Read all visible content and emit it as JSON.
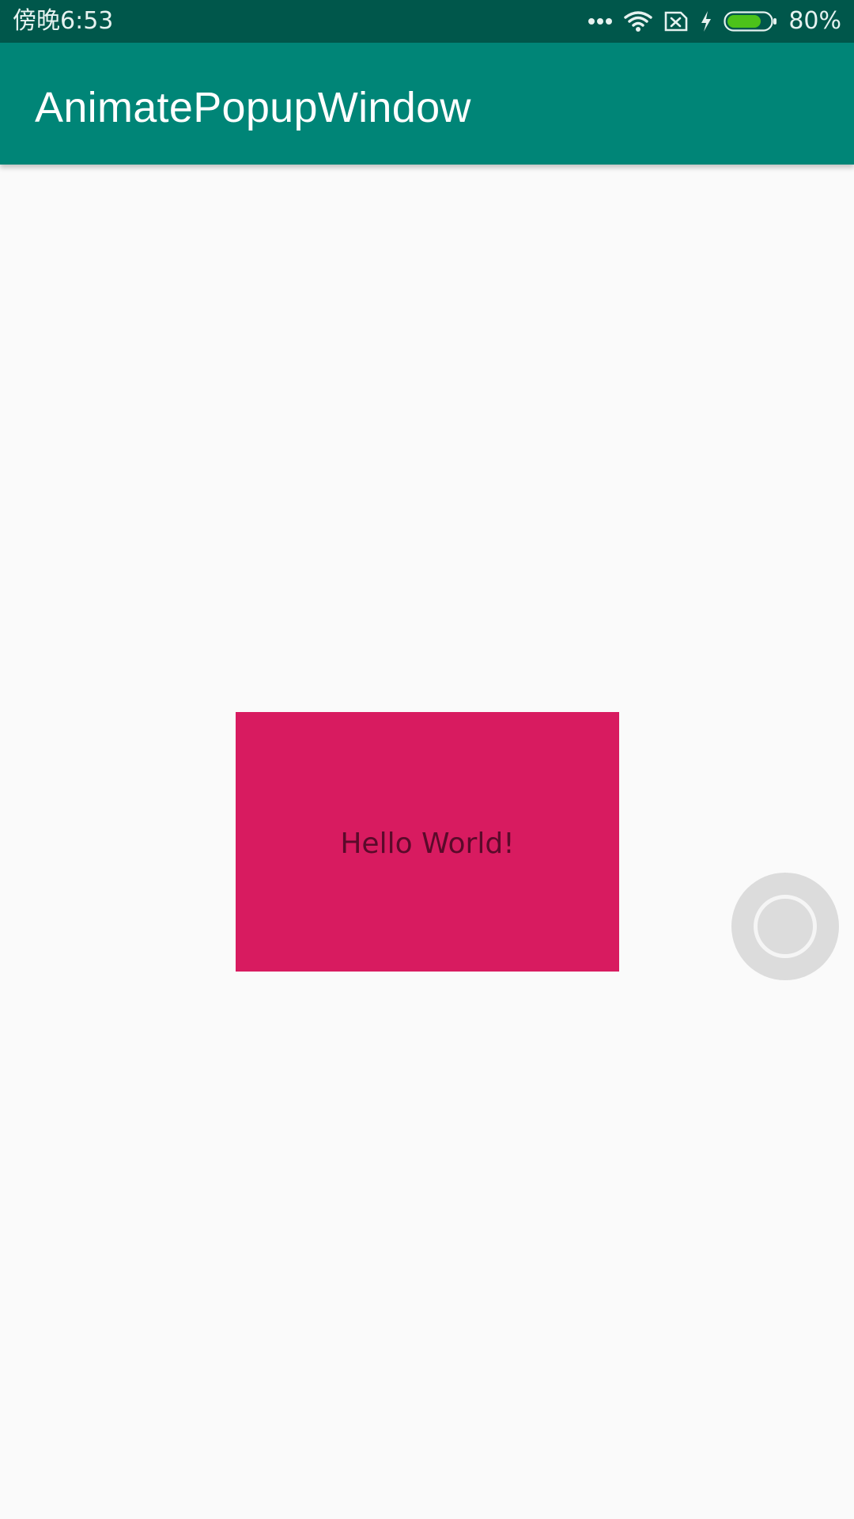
{
  "status_bar": {
    "time": "傍晚6:53",
    "battery_percent_label": "80%",
    "battery_level": 0.8,
    "icons": [
      "more-dots-icon",
      "wifi-icon",
      "no-sim-icon",
      "charging-bolt-icon",
      "battery-icon"
    ]
  },
  "app_bar": {
    "title": "AnimatePopupWindow"
  },
  "popup": {
    "text": "Hello World!"
  },
  "colors": {
    "status_bar": "#00574b",
    "app_bar": "#008577",
    "popup": "#d81b60",
    "background": "#fafafa"
  }
}
